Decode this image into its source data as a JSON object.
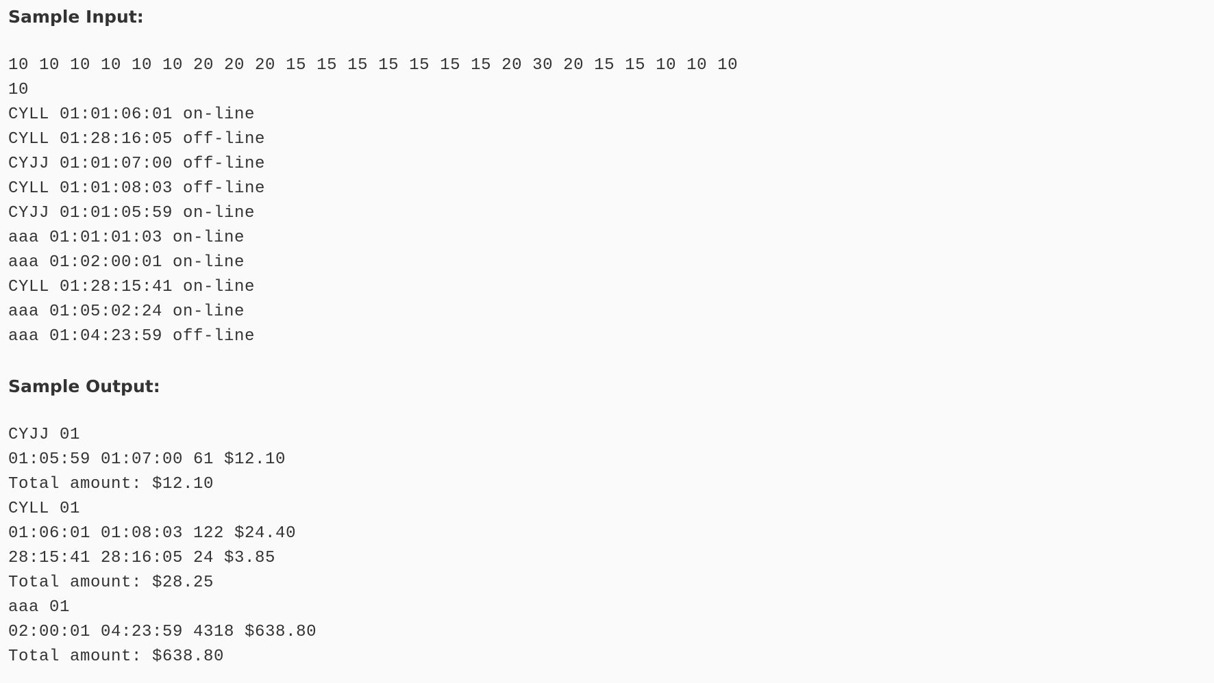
{
  "input_section": {
    "title": "Sample Input:",
    "lines": [
      "10 10 10 10 10 10 20 20 20 15 15 15 15 15 15 15 20 30 20 15 15 10 10 10",
      "10",
      "CYLL 01:01:06:01 on-line",
      "CYLL 01:28:16:05 off-line",
      "CYJJ 01:01:07:00 off-line",
      "CYLL 01:01:08:03 off-line",
      "CYJJ 01:01:05:59 on-line",
      "aaa 01:01:01:03 on-line",
      "aaa 01:02:00:01 on-line",
      "CYLL 01:28:15:41 on-line",
      "aaa 01:05:02:24 on-line",
      "aaa 01:04:23:59 off-line"
    ]
  },
  "output_section": {
    "title": "Sample Output:",
    "lines": [
      "CYJJ 01",
      "01:05:59 01:07:00 61 $12.10",
      "Total amount: $12.10",
      "CYLL 01",
      "01:06:01 01:08:03 122 $24.40",
      "28:15:41 28:16:05 24 $3.85",
      "Total amount: $28.25",
      "aaa 01",
      "02:00:01 04:23:59 4318 $638.80",
      "Total amount: $638.80"
    ]
  }
}
